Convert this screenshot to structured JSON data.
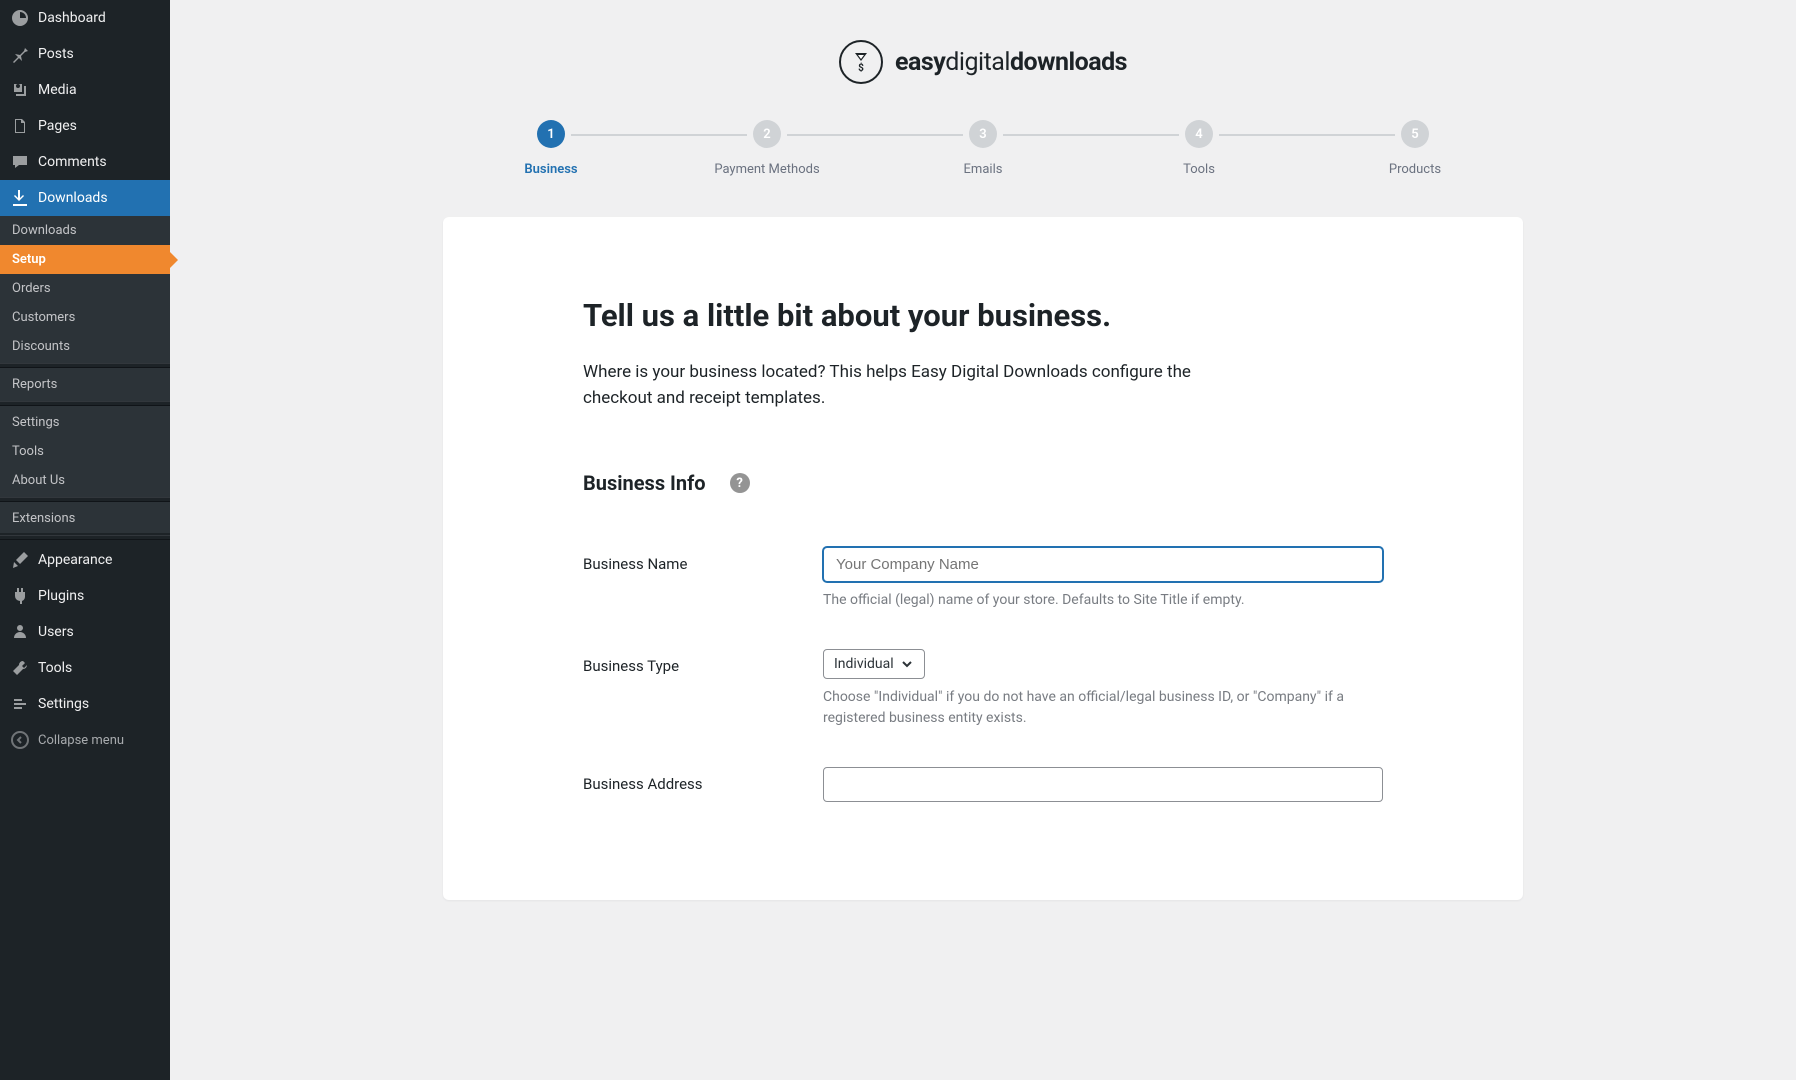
{
  "sidebar": {
    "dashboard": "Dashboard",
    "posts": "Posts",
    "media": "Media",
    "pages": "Pages",
    "comments": "Comments",
    "downloads": "Downloads",
    "sub_downloads": "Downloads",
    "sub_setup": "Setup",
    "sub_orders": "Orders",
    "sub_customers": "Customers",
    "sub_discounts": "Discounts",
    "sub_reports": "Reports",
    "sub_settings": "Settings",
    "sub_tools": "Tools",
    "sub_about": "About Us",
    "sub_extensions": "Extensions",
    "appearance": "Appearance",
    "plugins": "Plugins",
    "users": "Users",
    "tools": "Tools",
    "settings": "Settings",
    "collapse": "Collapse menu"
  },
  "logo": {
    "part1": "easy",
    "part2": "digital",
    "part3": "downloads"
  },
  "steps": [
    {
      "num": "1",
      "label": "Business"
    },
    {
      "num": "2",
      "label": "Payment Methods"
    },
    {
      "num": "3",
      "label": "Emails"
    },
    {
      "num": "4",
      "label": "Tools"
    },
    {
      "num": "5",
      "label": "Products"
    }
  ],
  "page": {
    "title": "Tell us a little bit about your business.",
    "desc": "Where is your business located? This helps Easy Digital Downloads configure the checkout and receipt templates.",
    "section_title": "Business Info",
    "help_glyph": "?",
    "fields": {
      "name_label": "Business Name",
      "name_placeholder": "Your Company Name",
      "name_value": "",
      "name_helper": "The official (legal) name of your store. Defaults to Site Title if empty.",
      "type_label": "Business Type",
      "type_value": "Individual",
      "type_helper": "Choose \"Individual\" if you do not have an official/legal business ID, or \"Company\" if a registered business entity exists.",
      "address_label": "Business Address",
      "address_value": ""
    }
  }
}
